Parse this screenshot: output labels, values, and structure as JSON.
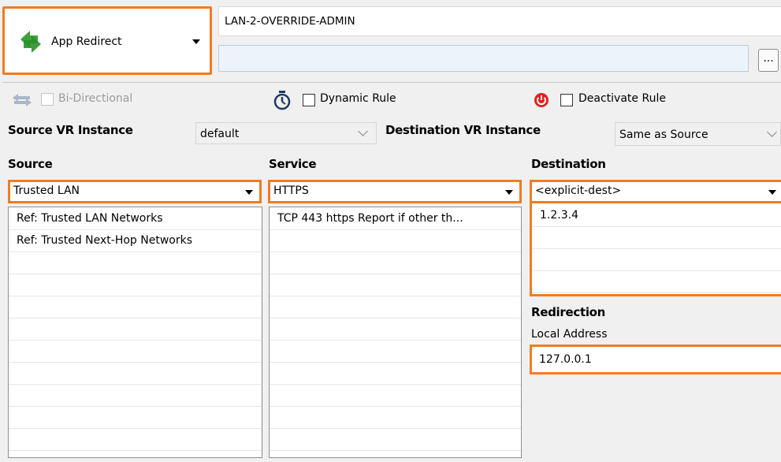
{
  "action": {
    "label": "App Redirect",
    "icon": "app-redirect-icon"
  },
  "rule": {
    "name": "LAN-2-OVERRIDE-ADMIN",
    "description": "",
    "more_label": "..."
  },
  "options": {
    "bidirectional": "Bi-Directional",
    "dynamic": "Dynamic Rule",
    "deactivate": "Deactivate Rule"
  },
  "vr": {
    "source_label": "Source VR Instance",
    "source_value": "default",
    "dest_label": "Destination VR Instance",
    "dest_value": "Same as Source"
  },
  "source": {
    "heading": "Source",
    "selected": "Trusted  LAN",
    "items": [
      "Ref: Trusted LAN Networks",
      "Ref: Trusted Next-Hop Networks"
    ]
  },
  "service": {
    "heading": "Service",
    "selected": "HTTPS",
    "items": [
      "TCP  443 https  Report if other th..."
    ]
  },
  "destination": {
    "heading": "Destination",
    "selected": "<explicit-dest>",
    "items": [
      "1.2.3.4"
    ]
  },
  "redirection": {
    "heading": "Redirection",
    "local_label": "Local Address",
    "local_value": "127.0.0.1"
  },
  "colors": {
    "highlight": "#f07c22",
    "redirect_green": "#2e9e2e",
    "power_red": "#e22020"
  }
}
